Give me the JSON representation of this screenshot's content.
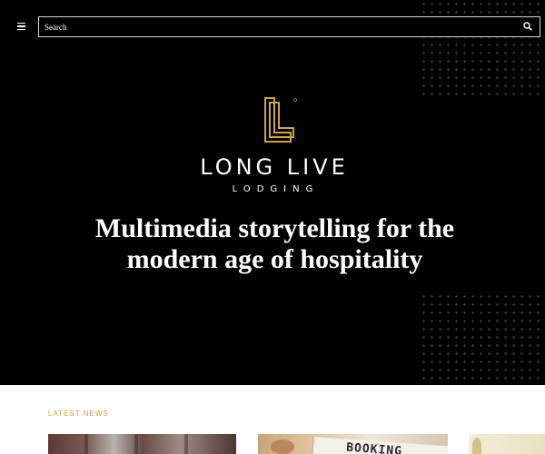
{
  "header": {
    "menu_icon": "hamburger-menu-icon",
    "search": {
      "placeholder": "Search",
      "value": "",
      "icon": "search-icon"
    }
  },
  "hero": {
    "background_color": "#000000",
    "logo_icon": "ll-monogram-logo",
    "logo_color": "#c9a449",
    "brand_name": "LONG LIVE",
    "brand_subtitle": "LODGING",
    "tagline": "Multimedia storytelling for the modern age of hospitality"
  },
  "latest_news": {
    "label": "LATEST NEWS",
    "label_color": "#c9a449",
    "cards": [
      {
        "image": "hotel-interior-photo"
      },
      {
        "image": "booking-sign-photo",
        "image_text": "BOOKING"
      },
      {
        "image": "light-interior-photo"
      }
    ]
  }
}
